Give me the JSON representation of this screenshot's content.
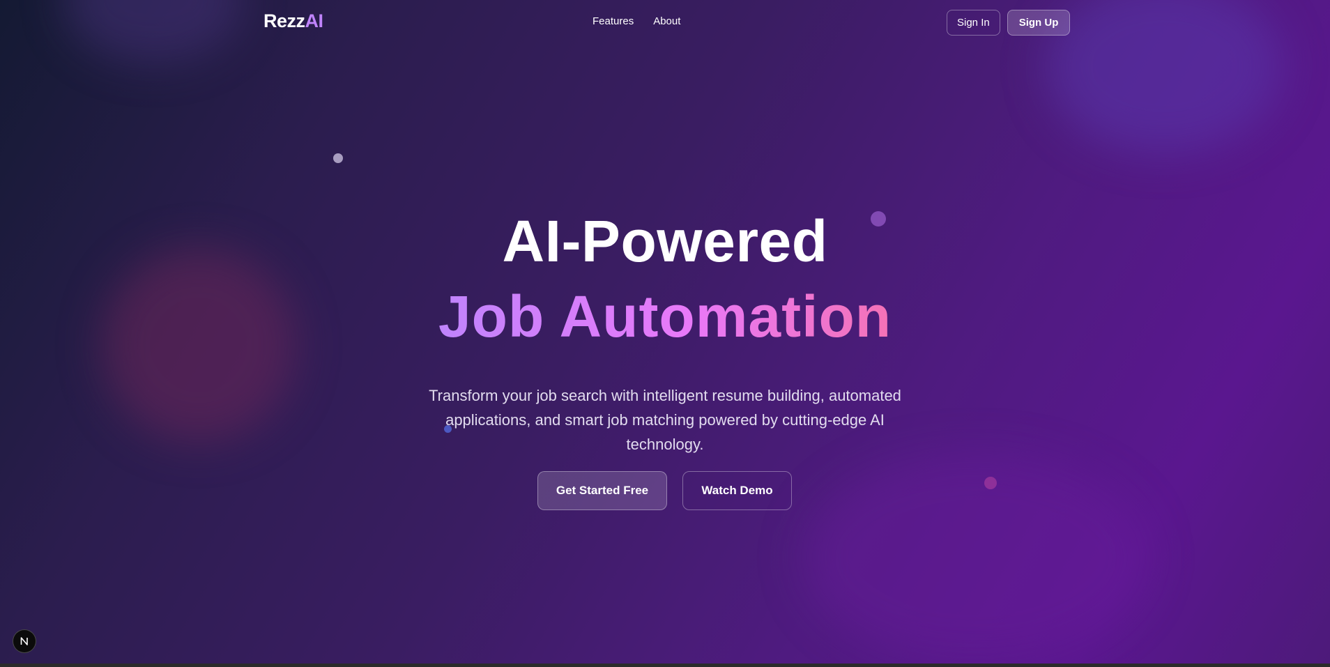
{
  "header": {
    "logo_primary": "Rezz",
    "logo_accent": "AI",
    "nav": [
      {
        "label": "Features"
      },
      {
        "label": "About"
      }
    ],
    "sign_in_label": "Sign In",
    "sign_up_label": "Sign Up"
  },
  "hero": {
    "line1": "AI-Powered",
    "line2": "Job Automation",
    "subtitle": "Transform your job search with intelligent resume building, automated applications, and smart job matching powered by cutting-edge AI technology.",
    "primary_cta": "Get Started Free",
    "secondary_cta": "Watch Demo"
  },
  "colors": {
    "accent": "#c084fc",
    "gradient_end": "#f472b6"
  },
  "badge": {
    "icon": "nextjs-n-icon"
  }
}
